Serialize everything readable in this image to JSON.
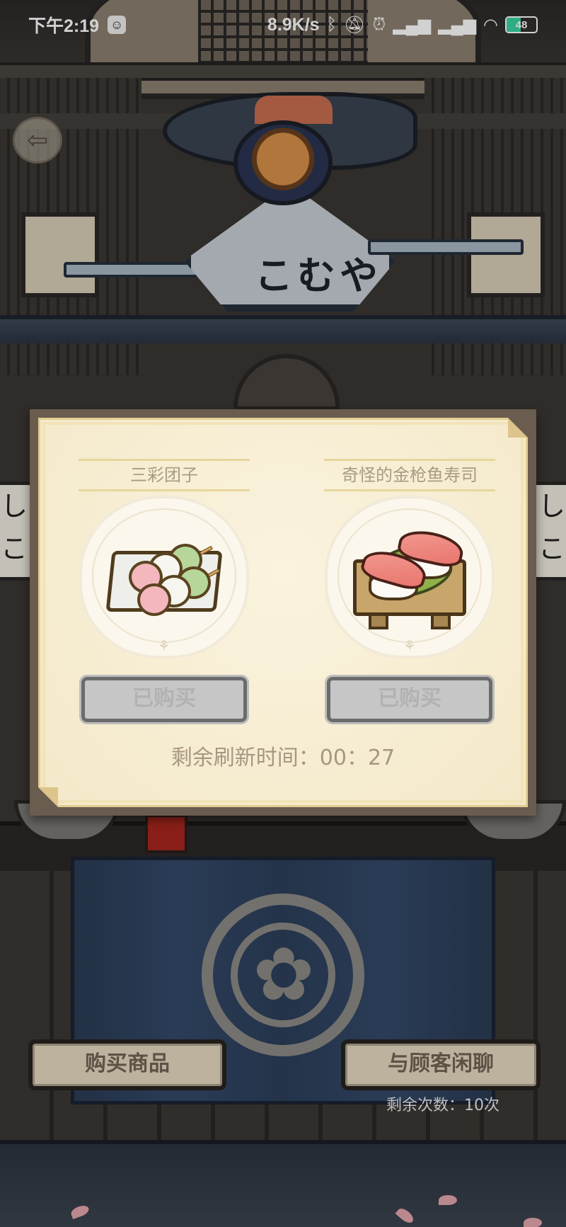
{
  "status_bar": {
    "time": "下午2:19",
    "net_speed": "8.9K/s",
    "battery": "48",
    "battery_level": 0.48
  },
  "shop_sign": {
    "text": "こむや"
  },
  "shop_dialog": {
    "items": [
      {
        "name": "三彩团子",
        "art": "dango-icon",
        "button_label": "已购买"
      },
      {
        "name": "奇怪的金枪鱼寿司",
        "art": "tuna-sushi-icon",
        "button_label": "已购买"
      }
    ],
    "refresh_label": "剩余刷新时间：00：27"
  },
  "actions": {
    "buy_label": "购买商品",
    "chat_label": "与顾客闲聊",
    "remaining_label": "剩余次数：10次"
  },
  "colors": {
    "paper": "#f4e8c8",
    "curtain": "#2c3f5a",
    "button_disabled": "#c6c6c6"
  }
}
